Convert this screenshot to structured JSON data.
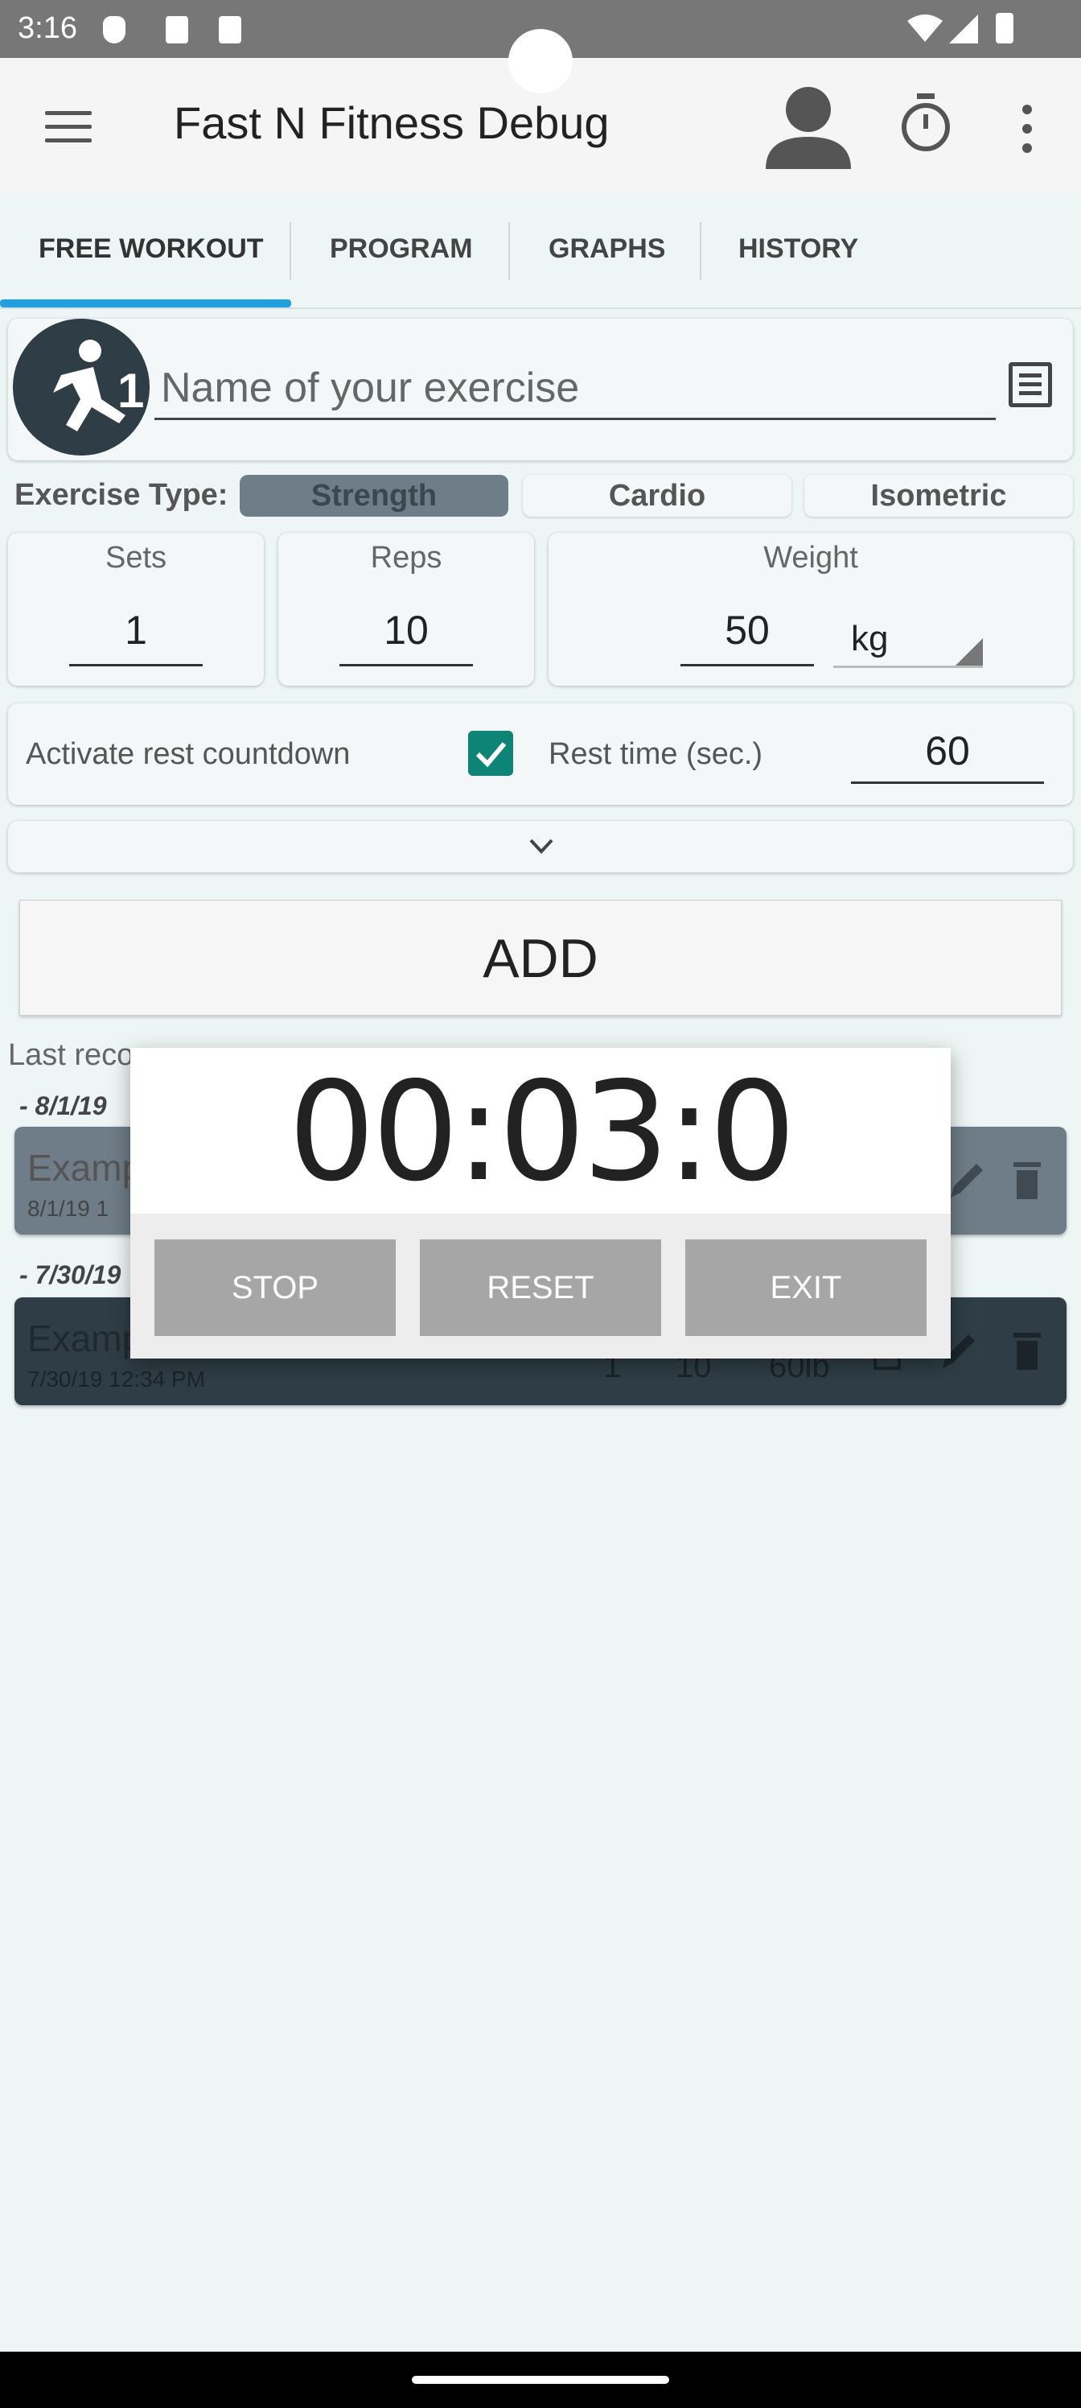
{
  "status_bar": {
    "time": "3:16"
  },
  "app_bar": {
    "title": "Fast N Fitness Debug"
  },
  "tabs": [
    {
      "label": "FREE WORKOUT"
    },
    {
      "label": "PROGRAM"
    },
    {
      "label": "GRAPHS"
    },
    {
      "label": "HISTORY"
    }
  ],
  "exercise": {
    "name_placeholder": "Name of your exercise",
    "type_label": "Exercise Type:",
    "types": [
      "Strength",
      "Cardio",
      "Isometric"
    ],
    "selected_type": "Strength"
  },
  "fields": {
    "sets_label": "Sets",
    "sets_value": "1",
    "reps_label": "Reps",
    "reps_value": "10",
    "weight_label": "Weight",
    "weight_value": "50",
    "unit": "kg"
  },
  "rest": {
    "label": "Activate rest countdown",
    "checked": true,
    "time_label": "Rest time (sec.)",
    "time_value": "60"
  },
  "add_button": "ADD",
  "last_records": {
    "label": "Last reco",
    "groups": [
      {
        "date": "- 8/1/19",
        "name": "Examp",
        "time": "8/1/19  1"
      },
      {
        "date": "- 7/30/19",
        "name": "Examp",
        "time": "7/30/19  12:34 PM",
        "sets": "1",
        "reps": "10",
        "weight": "60lb"
      }
    ]
  },
  "timer_dialog": {
    "display": "00:03:0",
    "stop": "STOP",
    "reset": "RESET",
    "exit": "EXIT"
  },
  "colors": {
    "accent": "#21a0e0",
    "checkbox": "#0d8576",
    "selected_type": "#6f7d88",
    "record_dark": "#2f3e46"
  }
}
